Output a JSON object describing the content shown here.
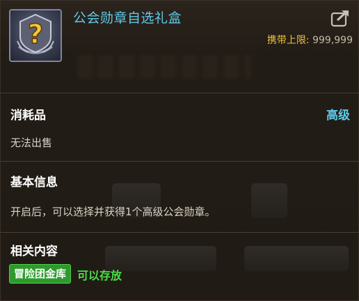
{
  "item": {
    "name": "公会勋章自选礼盒",
    "icon": "question-mark-medal-icon",
    "carry_limit_label": "携带上限",
    "carry_limit_sep": ":",
    "carry_limit_value": "999,999"
  },
  "category": {
    "type_label": "消耗品",
    "grade": "高级",
    "sell_status": "无法出售"
  },
  "basic_info": {
    "heading": "基本信息",
    "description": "开启后，可以选择并获得1个高级公会勋章。"
  },
  "related": {
    "heading": "相关内容",
    "tag": "冒险团金库",
    "tag_status": "可以存放"
  },
  "colors": {
    "title": "#5fc9e8",
    "limit_label": "#f0c23c",
    "grade": "#5fc9e8",
    "tag_bg": "#2e9a2e",
    "store_text": "#48e048"
  }
}
